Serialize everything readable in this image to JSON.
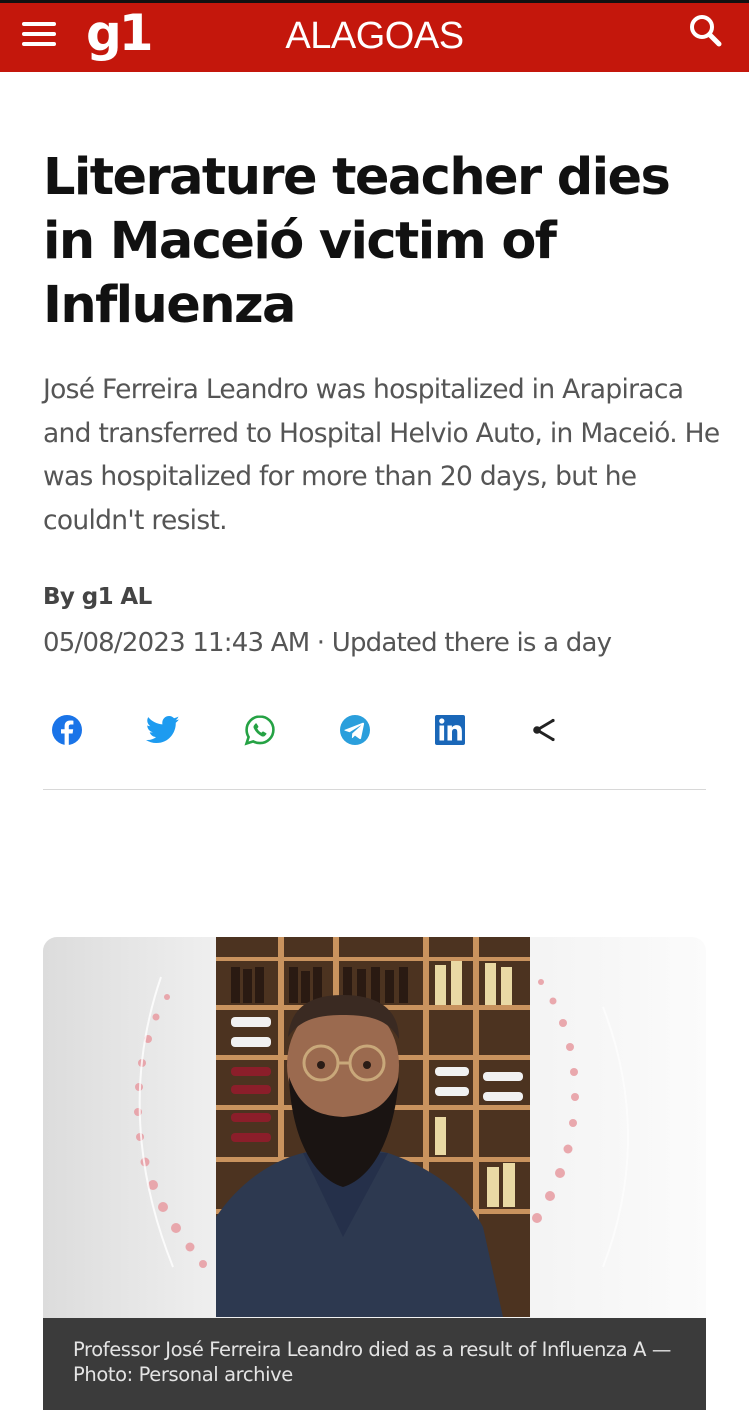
{
  "header": {
    "logo": "g1",
    "section": "ALAGOAS",
    "background_color": "#c4170c",
    "menu_icon": "hamburger-menu-icon",
    "search_icon": "search-icon"
  },
  "article": {
    "title": "Literature teacher dies in Maceió victim of Influenza",
    "subtitle": "José Ferreira Leandro was hospitalized in Arapiraca and transferred to Hospital Helvio Auto, in Maceió. He was hospitalized for more than 20 days, but he couldn't resist.",
    "byline": "By g1 AL",
    "dateline": "05/08/2023 11:43 AM · Updated there is a day"
  },
  "share": [
    {
      "name": "facebook",
      "icon": "facebook-icon",
      "color": "#1a74e8"
    },
    {
      "name": "twitter",
      "icon": "twitter-icon",
      "color": "#1d9bf0"
    },
    {
      "name": "whatsapp",
      "icon": "whatsapp-icon",
      "color": "#25a244"
    },
    {
      "name": "telegram",
      "icon": "telegram-icon",
      "color": "#2b9fdc"
    },
    {
      "name": "linkedin",
      "icon": "linkedin-icon",
      "color": "#1a67b8"
    },
    {
      "name": "share",
      "icon": "share-icon",
      "color": "#222222"
    }
  ],
  "photo": {
    "caption": "Professor José Ferreira Leandro died as a result of Influenza A — Photo: Personal archive"
  }
}
